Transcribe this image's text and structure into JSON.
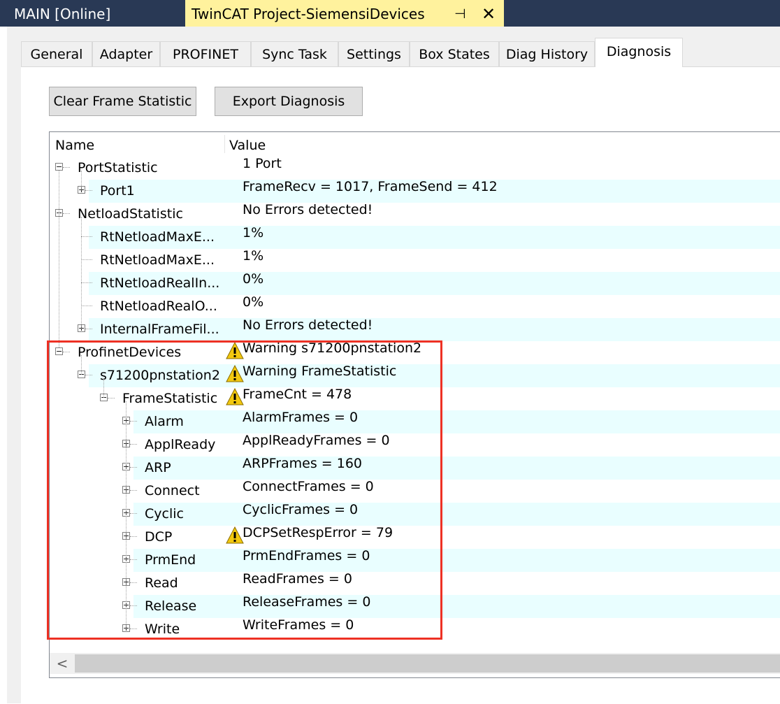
{
  "window": {
    "inactive_tab": "MAIN [Online]",
    "active_tab": "TwinCAT Project-SiemensiDevices",
    "pin_glyph": "⊣",
    "close_glyph": "✕"
  },
  "tabs": [
    {
      "label": "General"
    },
    {
      "label": "Adapter"
    },
    {
      "label": "PROFINET"
    },
    {
      "label": "Sync Task"
    },
    {
      "label": "Settings"
    },
    {
      "label": "Box States"
    },
    {
      "label": "Diag History"
    },
    {
      "label": "Diagnosis",
      "active": true
    }
  ],
  "buttons": {
    "clear_frame_statistic": "Clear Frame Statistic",
    "export_diagnosis": "Export Diagnosis"
  },
  "tree": {
    "columns": {
      "name": "Name",
      "value": "Value"
    },
    "rows": [
      {
        "name": "PortStatistic",
        "value": "1 Port",
        "level": 0,
        "expander": "minus",
        "warning": false,
        "shaded": false
      },
      {
        "name": "Port1",
        "value": "FrameRecv = 1017, FrameSend = 412",
        "level": 1,
        "expander": "plus",
        "warning": false,
        "shaded": true
      },
      {
        "name": "NetloadStatistic",
        "value": "No Errors detected!",
        "level": 0,
        "expander": "minus",
        "warning": false,
        "shaded": false
      },
      {
        "name": "RtNetloadMaxE...",
        "value": "1%",
        "level": 1,
        "expander": "none",
        "warning": false,
        "shaded": true
      },
      {
        "name": "RtNetloadMaxE...",
        "value": "1%",
        "level": 1,
        "expander": "none",
        "warning": false,
        "shaded": false
      },
      {
        "name": "RtNetloadRealIn...",
        "value": "0%",
        "level": 1,
        "expander": "none",
        "warning": false,
        "shaded": true
      },
      {
        "name": "RtNetloadRealO...",
        "value": "0%",
        "level": 1,
        "expander": "none",
        "warning": false,
        "shaded": false
      },
      {
        "name": "InternalFrameFil...",
        "value": "No Errors detected!",
        "level": 1,
        "expander": "plus",
        "warning": false,
        "shaded": true
      },
      {
        "name": "ProfinetDevices",
        "value": "Warning s71200pnstation2",
        "level": 0,
        "expander": "minus",
        "warning": true,
        "shaded": false
      },
      {
        "name": "s71200pnstation2",
        "value": "Warning FrameStatistic",
        "level": 1,
        "expander": "minus",
        "warning": true,
        "shaded": true
      },
      {
        "name": "FrameStatistic",
        "value": "FrameCnt = 478",
        "level": 2,
        "expander": "minus",
        "warning": true,
        "shaded": false
      },
      {
        "name": "Alarm",
        "value": "AlarmFrames = 0",
        "level": 3,
        "expander": "plus",
        "warning": false,
        "shaded": true
      },
      {
        "name": "ApplReady",
        "value": "ApplReadyFrames = 0",
        "level": 3,
        "expander": "plus",
        "warning": false,
        "shaded": false
      },
      {
        "name": "ARP",
        "value": "ARPFrames = 160",
        "level": 3,
        "expander": "plus",
        "warning": false,
        "shaded": true
      },
      {
        "name": "Connect",
        "value": "ConnectFrames = 0",
        "level": 3,
        "expander": "plus",
        "warning": false,
        "shaded": false
      },
      {
        "name": "Cyclic",
        "value": "CyclicFrames = 0",
        "level": 3,
        "expander": "plus",
        "warning": false,
        "shaded": true
      },
      {
        "name": "DCP",
        "value": "DCPSetRespError = 79",
        "level": 3,
        "expander": "plus",
        "warning": true,
        "shaded": false
      },
      {
        "name": "PrmEnd",
        "value": "PrmEndFrames = 0",
        "level": 3,
        "expander": "plus",
        "warning": false,
        "shaded": true
      },
      {
        "name": "Read",
        "value": "ReadFrames = 0",
        "level": 3,
        "expander": "plus",
        "warning": false,
        "shaded": false
      },
      {
        "name": "Release",
        "value": "ReleaseFrames = 0",
        "level": 3,
        "expander": "plus",
        "warning": false,
        "shaded": true
      },
      {
        "name": "Write",
        "value": "WriteFrames = 0",
        "level": 3,
        "expander": "plus",
        "warning": false,
        "shaded": false
      }
    ]
  },
  "scrollbar": {
    "left_arrow": "<"
  },
  "colors": {
    "titlebar": "#293955",
    "active_doc_tab": "#fff29d",
    "row_shade": "#e9feff",
    "highlight_border": "#ee3124",
    "warning_fill": "#f2c80f"
  },
  "icons": {
    "warning": "warning-icon",
    "expand": "plus-box-icon",
    "collapse": "minus-box-icon"
  }
}
